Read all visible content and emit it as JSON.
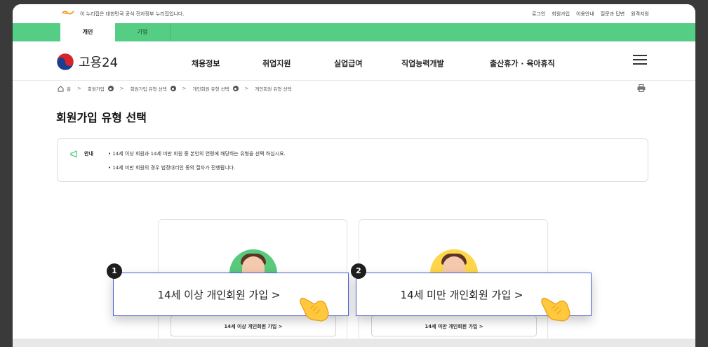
{
  "gov_banner": {
    "text": "이 누리집은 대한민국 공식 전자정부 누리집입니다.",
    "util_links": [
      "로그인",
      "회원가입",
      "이용안내",
      "질문과 답변",
      "원격지원"
    ]
  },
  "member_tabs": [
    "개인",
    "기업"
  ],
  "header": {
    "site_name": "고용24",
    "nav": [
      "채용정보",
      "취업지원",
      "실업급여",
      "직업능력개발",
      "출산휴가 · 육아휴직"
    ]
  },
  "breadcrumb": [
    "홈",
    "회원가입",
    "회원가입 유형 선택",
    "개인회원 유형 선택",
    "개인회원 유형 선택"
  ],
  "page_title": "회원가입 유형 선택",
  "notice": {
    "label": "안내",
    "lines": [
      "• 14세 이상 회원과 14세 미만 회원 중 본인의 연령에 해당하는 유형을 선택 하십시요.",
      "• 14세 미만 회원의 경우 법정대리인 동의 절차가 진행됩니다."
    ]
  },
  "cards": [
    {
      "button_label": "14세 이상 개인회원 가입 >"
    },
    {
      "button_label": "14세 미만 개인회원 가입 >"
    }
  ],
  "callouts": [
    {
      "number": "1",
      "label": "14세 이상 개인회원 가입 >"
    },
    {
      "number": "2",
      "label": "14세 미만 개인회원 가입 >"
    }
  ],
  "colors": {
    "accent_green": "#56cd85",
    "callout_border": "#4a5ed9"
  }
}
